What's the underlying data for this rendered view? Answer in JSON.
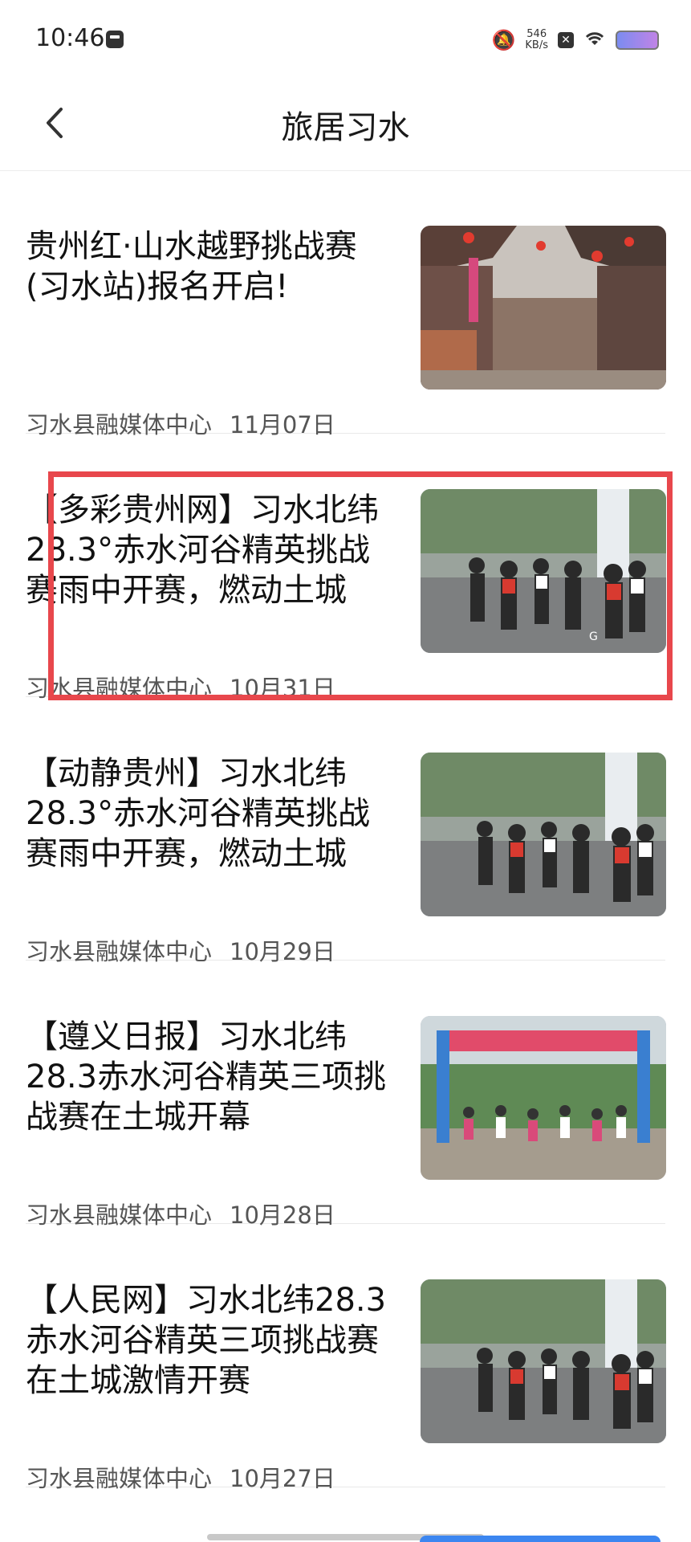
{
  "status_bar": {
    "time": "10:46",
    "speed_value": "546",
    "speed_unit": "KB/s"
  },
  "nav": {
    "title": "旅居习水",
    "back_icon": "chevron-left-icon"
  },
  "articles": [
    {
      "title": "贵州红·山水越野挑战赛(习水站)报名开启!",
      "source": "习水县融媒体中心",
      "date": "11月07日",
      "thumbnail": "old-street-lanterns"
    },
    {
      "title": "【多彩贵州网】习水北纬28.3°赤水河谷精英挑战赛雨中开赛，燃动土城",
      "source": "习水县融媒体中心",
      "date": "10月31日",
      "thumbnail": "cycling-race-rain"
    },
    {
      "title": "【动静贵州】习水北纬28.3°赤水河谷精英挑战赛雨中开赛，燃动土城",
      "source": "习水县融媒体中心",
      "date": "10月29日",
      "thumbnail": "cycling-race-rain"
    },
    {
      "title": "【遵义日报】习水北纬28.3赤水河谷精英三项挑战赛在土城开幕",
      "source": "习水县融媒体中心",
      "date": "10月28日",
      "thumbnail": "race-start-arch"
    },
    {
      "title": "【人民网】习水北纬28.3赤水河谷精英三项挑战赛在土城激情开赛",
      "source": "习水县融媒体中心",
      "date": "10月27日",
      "thumbnail": "cycling-race-rain"
    }
  ],
  "colors": {
    "highlight": "#e8474c",
    "accent_blue": "#3c86f0"
  }
}
